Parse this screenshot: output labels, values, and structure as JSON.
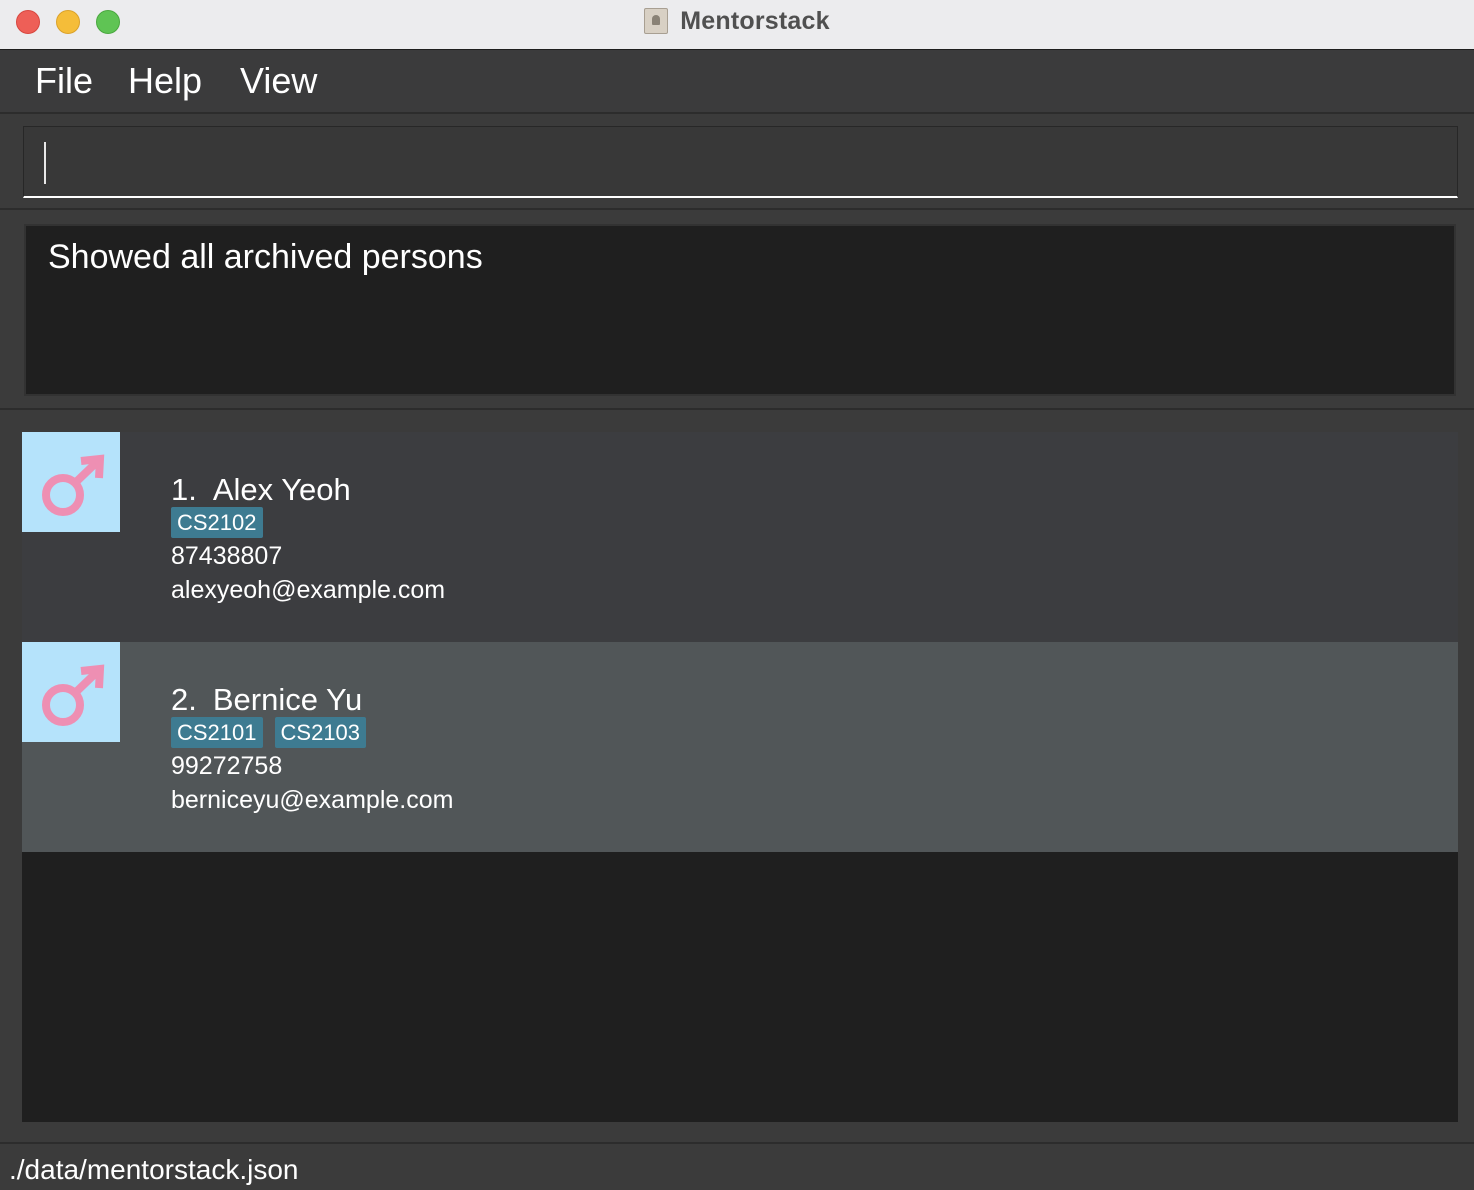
{
  "window": {
    "title": "Mentorstack"
  },
  "menu": {
    "file_label": "File",
    "help_label": "Help",
    "view_label": "View"
  },
  "command_box": {
    "value": "",
    "placeholder": ""
  },
  "result_display": {
    "message": "Showed all archived persons"
  },
  "persons": [
    {
      "index": "1.",
      "name": "Alex Yeoh",
      "tags": [
        "CS2102"
      ],
      "phone": "87438807",
      "email": "alexyeoh@example.com",
      "avatar_icon": "male-symbol-icon"
    },
    {
      "index": "2.",
      "name": "Bernice Yu",
      "tags": [
        "CS2101",
        "CS2103"
      ],
      "phone": "99272758",
      "email": "berniceyu@example.com",
      "avatar_icon": "male-symbol-icon"
    }
  ],
  "status_bar": {
    "save_location": "./data/mentorstack.json"
  },
  "colors": {
    "background": "#3b3b3b",
    "result_background": "#1f1f1f",
    "card_odd": "#3c3d40",
    "card_even": "#515658",
    "tag": "#3e7b91",
    "avatar_bg": "#b5e3fb",
    "avatar_symbol": "#ee8fb3"
  }
}
